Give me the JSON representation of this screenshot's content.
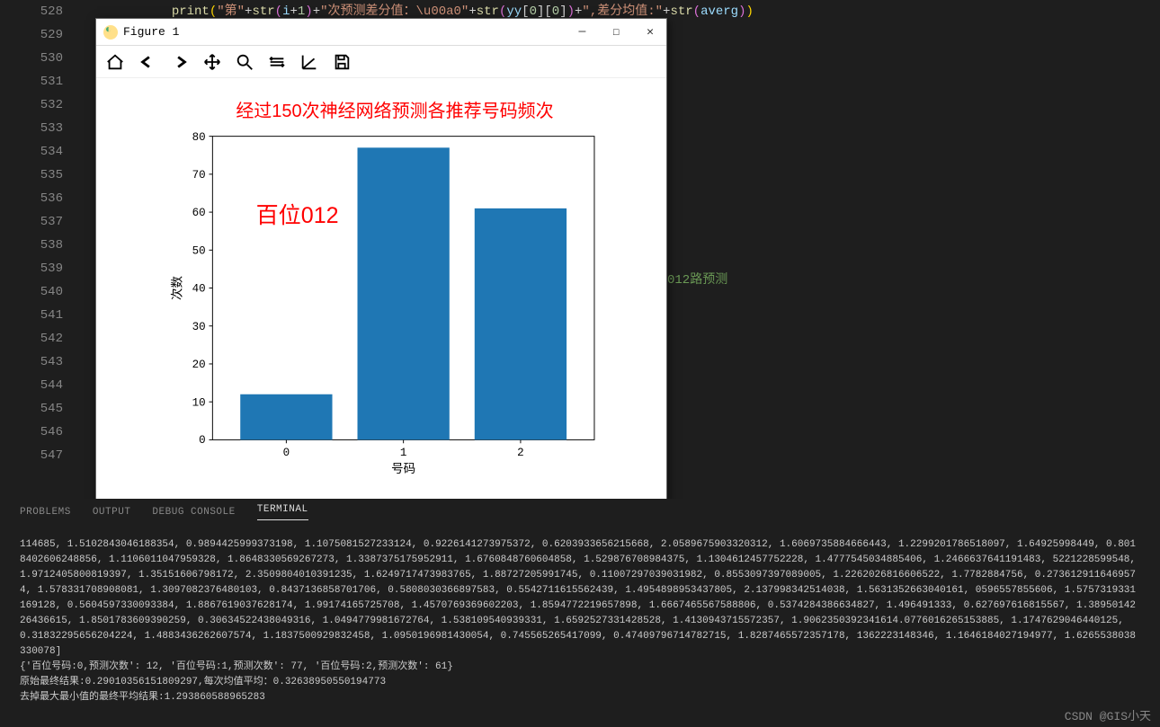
{
  "line_numbers": [
    "528",
    "529",
    "530",
    "531",
    "532",
    "533",
    "534",
    "535",
    "536",
    "537",
    "538",
    "539",
    "540",
    "541",
    "542",
    "543",
    "544",
    "545",
    "546",
    "547"
  ],
  "code_line_528": "print(\"第\"+str(i+1)+\"次预测差分值：\"+str(yy[0][0])+\",差分均值:\"+str(averg))",
  "comment_fragment": "012路预测",
  "figure": {
    "window_title": "Figure 1",
    "toolbar": [
      "home",
      "back",
      "forward",
      "pan",
      "zoom",
      "subplots",
      "axes",
      "save"
    ]
  },
  "chart_data": {
    "type": "bar",
    "title": "经过150次神经网络预测各推荐号码频次",
    "xlabel": "号码",
    "ylabel": "次数",
    "categories": [
      "0",
      "1",
      "2"
    ],
    "values": [
      12,
      77,
      61
    ],
    "ylim": [
      0,
      80
    ],
    "yticks": [
      0,
      10,
      20,
      30,
      40,
      50,
      60,
      70,
      80
    ],
    "annotation": "百位012"
  },
  "panel_tabs": {
    "problems": "PROBLEMS",
    "output": "OUTPUT",
    "debug_console": "DEBUG CONSOLE",
    "terminal": "TERMINAL"
  },
  "terminal_output": "114685, 1.5102843046188354, 0.9894425999373198, 1.1075081527233124, 0.9226141273975372, 0.6203933656215668, 2.0589675903320312, 1.6069735884666443, 1.2299201786518097, 1.64925998449, 0.8018402606248856, 1.1106011047959328, 1.8648330569267273, 1.3387375175952911, 1.6760848760604858, 1.529876708984375, 1.1304612457752228, 1.4777545034885406, 1.2466637641191483, 5221228599548, 1.9712405800819397, 1.35151606798172, 2.3509804010391235, 1.6249717473983765, 1.88727205991745, 0.11007297039031982, 0.8553097397089005, 1.2262026816606522, 1.7782884756, 0.2736129116469574, 1.578331708908081, 1.309708237648010​3, 0.8437136858701706, 0.5808030366897583, 0.5542711615562439, 1.4954898953437805, 2.137998342514038, 1.5631352663040161, 0596557855606, 1.575731933116912​8, 0.5604597330093384, 1.8867619037628174, 1.99174165725708, 1.4570769369602203, 1.8594772219657898, 1.6667465567588806, 0.5374284386634827, 1.496491333, 0.627697616815567, 1.3895014226436615, 1.8501783609390259, 0.30634522438049316, 1.0494779981672764, 1.538109540939331, 1.659252733142852​8, 1.4130943715572357, 1.9062350392341614.0776016265153885, 1.1747629046440125, 0.31832295656204224, 1.4883436262607574, 1.1837500929832458, 1.0950196981430054, 0.745565265417099, 0.47409796714782715, 1.8287465572357178, 13622231483​46, 1.1646184027194977, 1.6265538038330078]\n{'百位号码:0,预测次数': 12, '百位号码:1,预测次数': 77, '百位号码:2,预测次数': 61}\n原始最终结果:0.29010356151809297,每次均值平均：0.32638950550194773\n去掉最大最小值的最终平均结果:1.293860588965283",
  "watermark": "CSDN @GIS小天"
}
